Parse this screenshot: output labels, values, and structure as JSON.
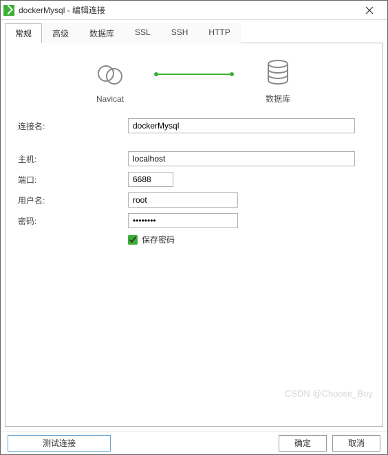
{
  "window": {
    "title": "dockerMysql - 编辑连接"
  },
  "tabs": [
    {
      "label": "常规",
      "active": true
    },
    {
      "label": "高级",
      "active": false
    },
    {
      "label": "数据库",
      "active": false
    },
    {
      "label": "SSL",
      "active": false
    },
    {
      "label": "SSH",
      "active": false
    },
    {
      "label": "HTTP",
      "active": false
    }
  ],
  "diagram": {
    "left_label": "Navicat",
    "right_label": "数据库"
  },
  "form": {
    "conn_name_label": "连接名:",
    "conn_name_value": "dockerMysql",
    "host_label": "主机:",
    "host_value": "localhost",
    "port_label": "端口:",
    "port_value": "6688",
    "user_label": "用户名:",
    "user_value": "root",
    "password_label": "密码:",
    "password_value": "••••••••",
    "save_password_label": "保存密码",
    "save_password_checked": true
  },
  "footer": {
    "test_label": "测试连接",
    "ok_label": "确定",
    "cancel_label": "取消"
  },
  "watermark": "CSDN @Choose_Boy"
}
